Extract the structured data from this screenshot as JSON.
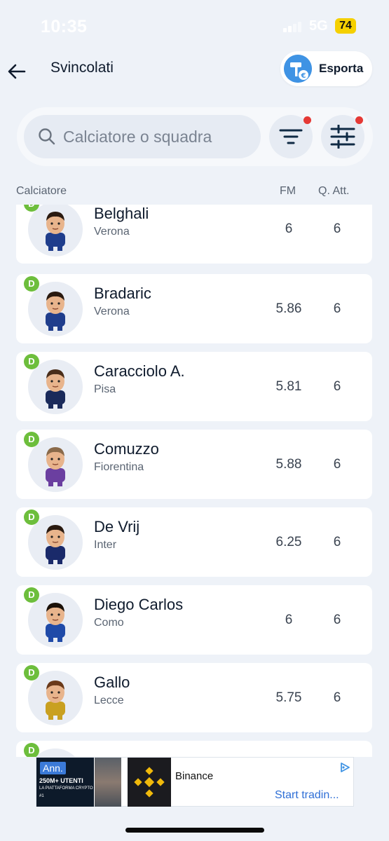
{
  "status_bar": {
    "time": "10:35",
    "network": "5G",
    "battery": "74"
  },
  "header": {
    "title": "Svincolati",
    "export_label": "Esporta"
  },
  "search": {
    "placeholder": "Calciatore o squadra",
    "value": ""
  },
  "filters": {
    "filter_has_active": true,
    "settings_has_active": true
  },
  "columns": {
    "player": "Calciatore",
    "fm": "FM",
    "qatt": "Q. Att."
  },
  "players": [
    {
      "role": "D",
      "name": "Belghali",
      "team": "Verona",
      "fm": "6",
      "qatt": "6",
      "kit": "#1f3d8c",
      "hair": "#2a1a10"
    },
    {
      "role": "D",
      "name": "Bradaric",
      "team": "Verona",
      "fm": "5.86",
      "qatt": "6",
      "kit": "#1f3d8c",
      "hair": "#2a1a10"
    },
    {
      "role": "D",
      "name": "Caracciolo A.",
      "team": "Pisa",
      "fm": "5.81",
      "qatt": "6",
      "kit": "#1a2a5a",
      "hair": "#4a2e1a"
    },
    {
      "role": "D",
      "name": "Comuzzo",
      "team": "Fiorentina",
      "fm": "5.88",
      "qatt": "6",
      "kit": "#6b3fa0",
      "hair": "#8a6a4a"
    },
    {
      "role": "D",
      "name": "De Vrij",
      "team": "Inter",
      "fm": "6.25",
      "qatt": "6",
      "kit": "#1a2a6a",
      "hair": "#2a1a10"
    },
    {
      "role": "D",
      "name": "Diego Carlos",
      "team": "Como",
      "fm": "6",
      "qatt": "6",
      "kit": "#1f4aa8",
      "hair": "#1a1008"
    },
    {
      "role": "D",
      "name": "Gallo",
      "team": "Lecce",
      "fm": "5.75",
      "qatt": "6",
      "kit": "#c9a020",
      "hair": "#6a3a1a"
    },
    {
      "role": "D",
      "name": "",
      "team": "",
      "fm": "",
      "qatt": "",
      "kit": "#888888",
      "hair": "#333333"
    }
  ],
  "ad": {
    "badge": "Ann.",
    "promo_line1": "250M+ UTENTI",
    "promo_line2": "LA PIATTAFORMA CRYPTO #1",
    "brand": "Binance",
    "cta": "Start tradin..."
  }
}
